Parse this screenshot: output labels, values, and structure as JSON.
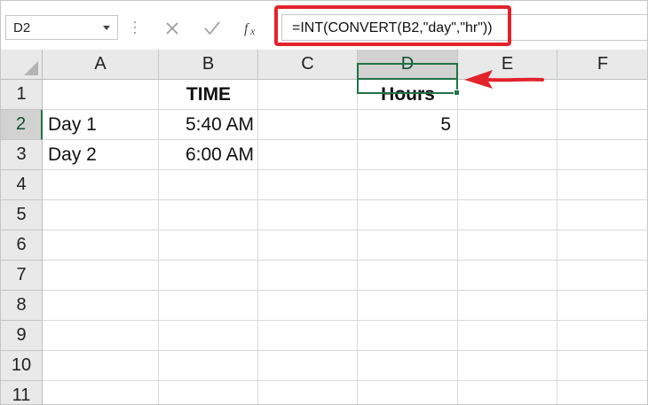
{
  "namebox": {
    "value": "D2"
  },
  "formula_bar": {
    "formula": "=INT(CONVERT(B2,\"day\",\"hr\"))",
    "icons": [
      "cancel-icon",
      "enter-check-icon",
      "insert-function-icon"
    ]
  },
  "columns": [
    "A",
    "B",
    "C",
    "D",
    "E",
    "F"
  ],
  "rows": [
    "1",
    "2",
    "3",
    "4",
    "5",
    "6",
    "7",
    "8",
    "9",
    "10",
    "11"
  ],
  "selected": {
    "column": "D",
    "row": "2"
  },
  "cells": {
    "B1": "TIME",
    "D1": "Hours",
    "A2": "Day 1",
    "B2": "5:40 AM",
    "D2": "5",
    "A3": "Day 2",
    "B3": "6:00 AM"
  },
  "colors": {
    "accent_green": "#217346",
    "highlight_red": "#e3232b"
  }
}
